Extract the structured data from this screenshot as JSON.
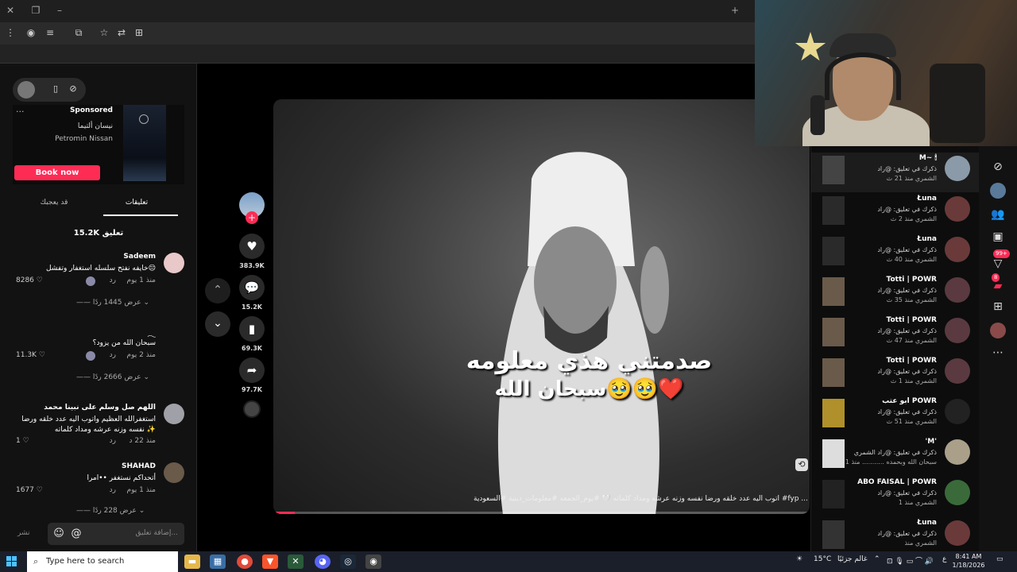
{
  "left_panel": {
    "ad": {
      "sponsored": "Sponsored",
      "brand": "نيسان ألتيما",
      "advertiser": "Petromin Nissan",
      "cta": "Book now"
    },
    "tabs": [
      "قد يعجبك",
      "تعليقات"
    ],
    "comment_count": "15.2K تعليق",
    "comments": [
      {
        "name": "Sadeem",
        "text": "خايفه نفتح سلسله استغفار وتفشل😔",
        "meta": "منذ 1 يوم",
        "reply": "رد",
        "likes": "8286",
        "view_replies": "عرض 1445 ردًا"
      },
      {
        "name": "𓂃",
        "text": "سبحان الله من يزود؟",
        "meta": "منذ 2 يوم",
        "reply": "رد",
        "likes": "11.3K",
        "view_replies": "عرض 2666 ردًا"
      },
      {
        "name": "اللهم صل وسلم على نبينا محمد",
        "text": "استغفرالله العظيم واتوب اليه عدد خلقه ورضا نفسه وزنه عرشه ومداد كلماته ✨",
        "meta": "منذ 22 د",
        "reply": "رد",
        "likes": "1",
        "view_replies": ""
      },
      {
        "name": "SHAHAD",
        "text": "أتحداكم نستغفر ••امرا",
        "meta": "منذ 1 يوم",
        "reply": "رد",
        "likes": "1677",
        "view_replies": "عرض 228 ردًا"
      }
    ],
    "input_placeholder": "إضافة تعليق...",
    "post_label": "نشر"
  },
  "video": {
    "overlay_line1": "صدمتني هذي معلومه",
    "overlay_line2": "سبحان الله🥹🥹❤️",
    "caption": "اتوب اليه عدد خلقه ورضا نفسه وزنه عرشه ومداد كلماته 🤍 #يوم_الجمعه #معلومات_دينية #السعودية #fyp ...",
    "progress": 0.04
  },
  "actions": {
    "likes": "383.9K",
    "comments": "15.2K",
    "saves": "69.3K",
    "shares": "97.7K"
  },
  "right_panel": {
    "items": [
      {
        "name": "M~ 🕯",
        "line2": "ذكرك في تعليق: @راد",
        "line3": "الشمري منذ 21 ث",
        "selected": true
      },
      {
        "name": "Łuna",
        "line2": "ذكرك في تعليق: @راد",
        "line3": "الشمري منذ 2 ث",
        "selected": false
      },
      {
        "name": "Łuna",
        "line2": "ذكرك في تعليق: @راد",
        "line3": "الشمري منذ 40 ث",
        "selected": false
      },
      {
        "name": "Totti | POWR",
        "line2": "ذكرك في تعليق: @راد",
        "line3": "الشمري منذ 35 ث",
        "selected": false
      },
      {
        "name": "Totti | POWR",
        "line2": "ذكرك في تعليق: @راد",
        "line3": "الشمري منذ 47 ث",
        "selected": false
      },
      {
        "name": "Totti | POWR",
        "line2": "ذكرك في تعليق: @راد",
        "line3": "الشمري منذ 1 ث",
        "selected": false
      },
      {
        "name": "ابو عتب POWR",
        "line2": "ذكرك في تعليق: @راد",
        "line3": "الشمري منذ 51 ث",
        "selected": false
      },
      {
        "name": "'M'",
        "line2": "ذكرك في تعليق: @راد الشمري",
        "line3": "سبحان الله وبحمده ........... منذ 1",
        "selected": false
      },
      {
        "name": "ABO FAISAL | POWR",
        "line2": "ذكرك في تعليق: @راد",
        "line3": "الشمري منذ 1",
        "selected": false
      },
      {
        "name": "Łuna",
        "line2": "ذكرك في تعليق: @راد",
        "line3": "الشمري منذ",
        "selected": false
      }
    ]
  },
  "sidebar": {
    "badge_inbox": "99+",
    "badge_messages": "8"
  },
  "taskbar": {
    "search_placeholder": "Type here to search",
    "weather": "15°C",
    "weather_text": "غالم جزئيًا",
    "lang": "ع",
    "time": "8:41 AM",
    "date": "1/18/2026"
  }
}
